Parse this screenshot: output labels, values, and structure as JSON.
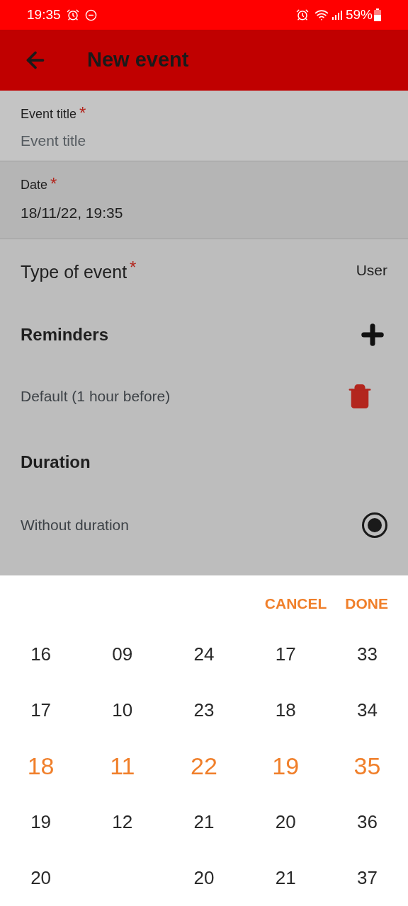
{
  "status_bar": {
    "time": "19:35",
    "battery": "59%"
  },
  "app_bar": {
    "title": "New event"
  },
  "fields": [
    {
      "label": "Event title",
      "required_mark": "*",
      "placeholder": "Event title"
    },
    {
      "label": "Date",
      "required_mark": "*",
      "value": "18/11/22, 19:35"
    }
  ],
  "type_of_event": {
    "label": "Type of event",
    "required_mark": "*",
    "value": "User"
  },
  "reminders": {
    "title": "Reminders",
    "items": [
      {
        "text": "Default (1 hour before)"
      }
    ]
  },
  "duration": {
    "title": "Duration",
    "options": [
      {
        "label": "Without duration",
        "selected": true
      }
    ]
  },
  "picker": {
    "buttons": [
      "CANCEL",
      "DONE"
    ],
    "columns": [
      {
        "items": [
          {
            "text": "16",
            "selected": false
          },
          {
            "text": "17",
            "selected": false
          },
          {
            "text": "18",
            "selected": true
          },
          {
            "text": "19",
            "selected": false
          },
          {
            "text": "20",
            "selected": false
          }
        ]
      },
      {
        "items": [
          {
            "text": "09",
            "selected": false
          },
          {
            "text": "10",
            "selected": false
          },
          {
            "text": "11",
            "selected": true
          },
          {
            "text": "12",
            "selected": false
          }
        ]
      },
      {
        "items": [
          {
            "text": "24",
            "selected": false
          },
          {
            "text": "23",
            "selected": false
          },
          {
            "text": "22",
            "selected": true
          },
          {
            "text": "21",
            "selected": false
          },
          {
            "text": "20",
            "selected": false
          }
        ]
      },
      {
        "items": [
          {
            "text": "17",
            "selected": false
          },
          {
            "text": "18",
            "selected": false
          },
          {
            "text": "19",
            "selected": true
          },
          {
            "text": "20",
            "selected": false
          },
          {
            "text": "21",
            "selected": false
          }
        ]
      },
      {
        "items": [
          {
            "text": "33",
            "selected": false
          },
          {
            "text": "34",
            "selected": false
          },
          {
            "text": "35",
            "selected": true
          },
          {
            "text": "36",
            "selected": false
          },
          {
            "text": "37",
            "selected": false
          }
        ]
      }
    ]
  }
}
